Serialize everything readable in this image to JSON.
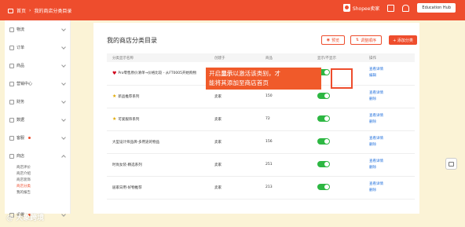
{
  "topbar": {
    "breadcrumb_home": "首页",
    "breadcrumb_current": "我的商店分类目录",
    "brand": "Shopee卖家",
    "user": "Education Hub"
  },
  "sidebar": {
    "items": [
      {
        "label": "物流"
      },
      {
        "label": "订单"
      },
      {
        "label": "商品"
      },
      {
        "label": "营销中心"
      },
      {
        "label": "财务"
      },
      {
        "label": "数据"
      },
      {
        "label": "客服"
      },
      {
        "label": "商店"
      },
      {
        "label": "设置"
      }
    ],
    "shop_sub_items": [
      "商店评价",
      "商店介绍",
      "商店装饰",
      "商店分类",
      "我的报告"
    ]
  },
  "main": {
    "title": "我的商店分类目录",
    "btn_preview": "预览",
    "btn_adjust": "调整顺序",
    "btn_add": "+ 添加分类",
    "columns": [
      "分类显示名称",
      "创建于",
      "商品",
      "显示/不显示",
      "操作"
    ],
    "rows": [
      {
        "icon": "heart",
        "name": "Pro零售原价清单→价格比较 - 从FT0005开始购物",
        "creator": "",
        "count": "",
        "op1": "查看详情",
        "op2": "编辑"
      },
      {
        "icon": "star",
        "name": "新品推荐系列",
        "creator": "卖家",
        "count": "150",
        "op1": "查看详情",
        "op2": "删除"
      },
      {
        "icon": "star",
        "name": "可爱服饰系列",
        "creator": "卖家",
        "count": "72",
        "op1": "查看详情",
        "op2": "删除"
      },
      {
        "icon": "",
        "name": "大型设计师品牌-多用途的物品",
        "creator": "卖家",
        "count": "156",
        "op1": "查看详情",
        "op2": "删除"
      },
      {
        "icon": "",
        "name": "时尚女装-精选系列",
        "creator": "卖家",
        "count": "251",
        "op1": "查看详情",
        "op2": "删除"
      },
      {
        "icon": "",
        "name": "居家日用-好物推荐",
        "creator": "卖家",
        "count": "213",
        "op1": "查看详情",
        "op2": "删除"
      }
    ],
    "callout_line1_a": "开启",
    "callout_line1_b": "显示",
    "callout_line1_c": "以激活该类别，才",
    "callout_line2": "能将其添加至商店首页"
  },
  "watermark": "@ 大象跨境",
  "colors": {
    "accent": "#ee4d2d",
    "toggle_on": "#2db742",
    "link": "#2673dd"
  }
}
